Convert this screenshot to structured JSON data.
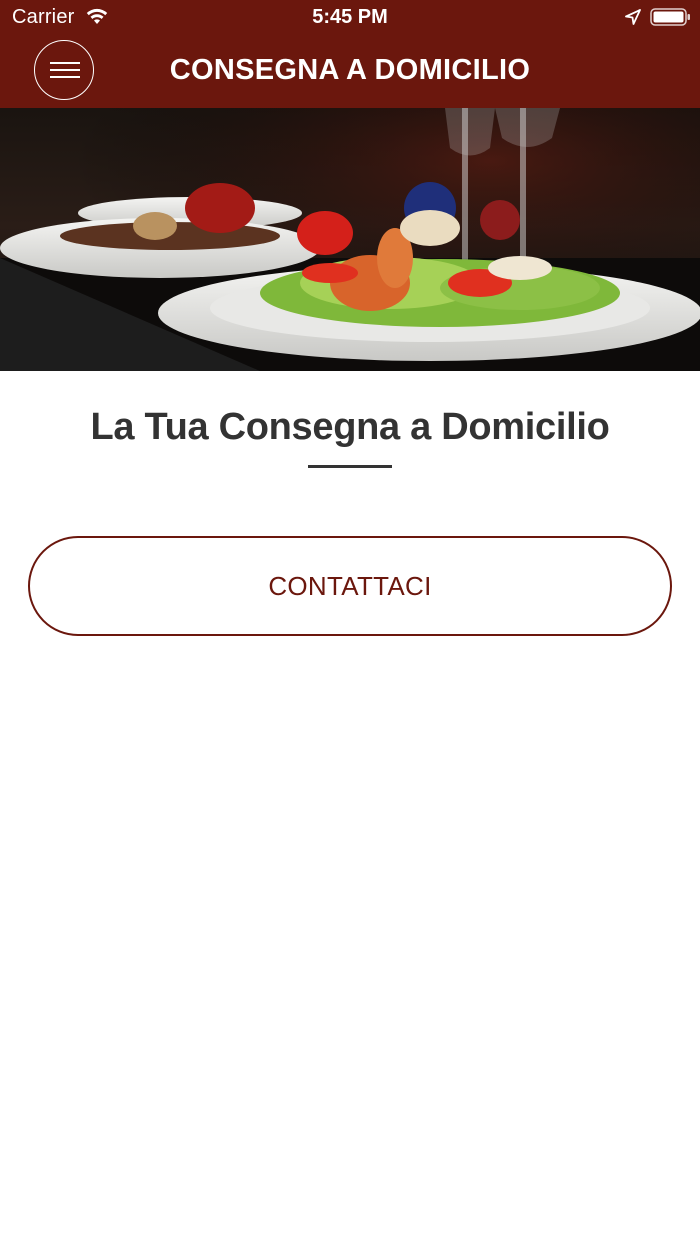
{
  "status_bar": {
    "carrier": "Carrier",
    "time": "5:45 PM",
    "icons": [
      "wifi-icon",
      "location-arrow-icon",
      "battery-icon"
    ]
  },
  "header": {
    "menu_icon": "hamburger-menu-icon",
    "title": "CONSEGNA A DOMICILIO"
  },
  "hero": {
    "image": "food-plates-photo"
  },
  "content": {
    "title": "La Tua Consegna a Domicilio",
    "contact_button_label": "CONTATTACI"
  },
  "colors": {
    "brand": "#6b170d",
    "text_dark": "#333333",
    "background": "#ffffff"
  }
}
